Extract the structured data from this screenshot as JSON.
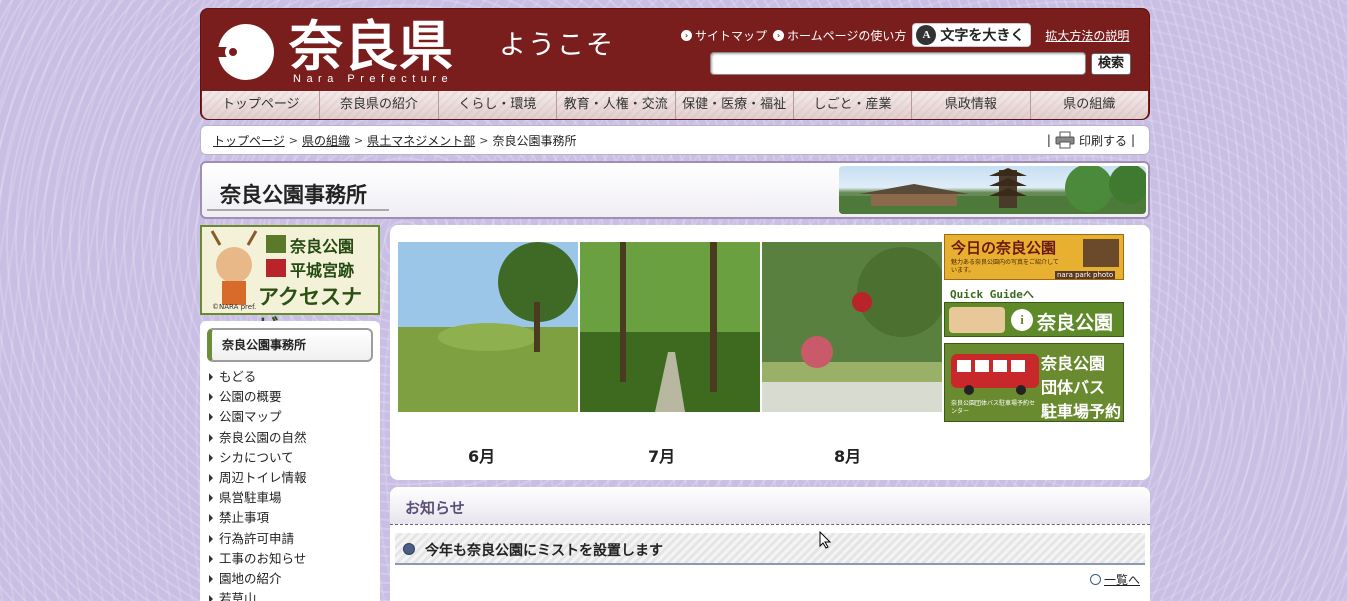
{
  "header": {
    "logo_text": "奈良県",
    "logo_sub": "Nara Prefecture",
    "welcome": "ようこそ",
    "sitemap": "サイトマップ",
    "howto": "ホームページの使い方",
    "bigtext": "文字を大きく",
    "bigtext_icon": "A",
    "help": "拡大方法の説明",
    "search_button": "検索",
    "search_placeholder": ""
  },
  "nav": [
    "トップページ",
    "奈良県の紹介",
    "くらし・環境",
    "教育・人権・交流",
    "保健・医療・福祉",
    "しごと・産業",
    "県政情報",
    "県の組織"
  ],
  "breadcrumb": {
    "items": [
      "トップページ",
      "県の組織",
      "県土マネジメント部"
    ],
    "current": "奈良公園事務所",
    "print": "印刷する"
  },
  "page_title": "奈良公園事務所",
  "access_navi": {
    "line1": "奈良公園",
    "line2": "平城宮跡",
    "line3": "アクセスナビ",
    "credit": "©NARA pref."
  },
  "left_nav": {
    "heading": "奈良公園事務所",
    "items": [
      "もどる",
      "公園の概要",
      "公園マップ",
      "奈良公園の自然",
      "シカについて",
      "周辺トイレ情報",
      "県営駐車場",
      "禁止事項",
      "行為許可申請",
      "工事のお知らせ",
      "園地の紹介",
      "若草山"
    ]
  },
  "photos": [
    "6月",
    "7月",
    "8月"
  ],
  "side_banners": {
    "today": "今日の奈良公園",
    "today_sub": "魅力ある奈良公園内の写真をご紹介しています。",
    "today_tag": "nara park photo",
    "quick": "Quick Guideへ",
    "guide_name": "奈良公園",
    "bus_line1": "奈良公園",
    "bus_line2": "団体バス",
    "bus_line3": "駐車場予約",
    "bus_sub": "奈良公園団体バス駐車場予約センター"
  },
  "news": {
    "heading": "お知らせ",
    "item": "今年も奈良公園にミストを設置します",
    "more": "一覧へ"
  },
  "colors": {
    "header_bg": "#7a1d1d",
    "page_bg": "#c9bfe4",
    "accent_green": "#6a8a2e"
  }
}
